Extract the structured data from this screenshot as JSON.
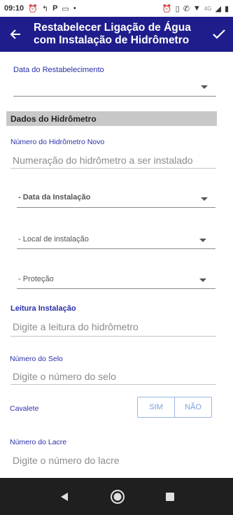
{
  "status_bar": {
    "time": "09:10",
    "network": "4G"
  },
  "app_bar": {
    "title": "Restabelecer Ligação de Água com Instalação de Hidrômetro"
  },
  "form": {
    "data_restabelecimento_label": "Data do Restabelecimento",
    "section_title": "Dados do Hidrômetro",
    "numero_hidrometro_label": "Número do Hidrômetro Novo",
    "numero_hidrometro_placeholder": "Numeração do hidrômetro a ser instalado",
    "data_instalacao": "- Data da Instalação",
    "local_instalacao": "- Local de instalação",
    "protecao": "- Proteção",
    "leitura_label": "Leitura Instalação",
    "leitura_placeholder": "Digite a leitura do hidrômetro",
    "numero_selo_label": "Número do Selo",
    "numero_selo_placeholder": "Digite o número do selo",
    "cavalete_label": "Cavalete",
    "cavalete_options": [
      "SIM",
      "NÃO"
    ],
    "numero_lacre_label": "Número do Lacre",
    "numero_lacre_placeholder": "Digite o número do lacre"
  },
  "colors": {
    "app_bar": "#1f1d8c",
    "label_blue": "#2a2fa8",
    "segment": "#7aa0dc"
  },
  "icons": [
    "back-arrow-icon",
    "check-icon",
    "nav-back-icon",
    "nav-home-icon",
    "nav-recents-icon"
  ]
}
